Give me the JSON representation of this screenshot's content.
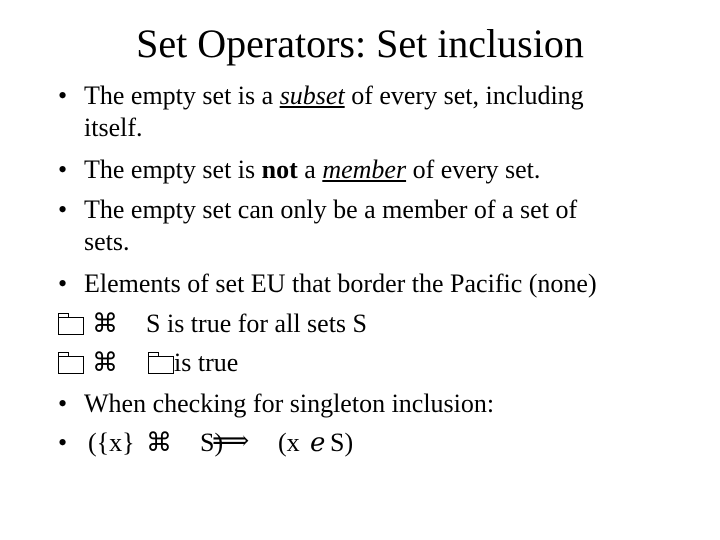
{
  "title": "Set Operators: Set inclusion",
  "bullet_char": "•",
  "items": [
    {
      "pre": "The empty set is a ",
      "em": "subset",
      "post": " of every set, including",
      "cont": "itself."
    },
    {
      "pre": "The empty set is ",
      "bold": "not",
      "mid": " a ",
      "em": "member",
      "post": " of every set."
    },
    {
      "text": "The empty set can only be a member of a set of",
      "cont": "sets."
    },
    {
      "text": "Elements of set EU that border the Pacific (none)"
    },
    {
      "symbol": "⌘",
      "s": "S",
      "rest": " is true for all sets S"
    },
    {
      "symbol": "⌘",
      "rest": " is true"
    },
    {
      "text": "When checking for singleton inclusion:"
    },
    {
      "left": "({x}",
      "symbol": "⌘",
      "s": "S)",
      "arrow": "⟹",
      "right_open": "(x",
      "member_symbol": "ℯ",
      "right_close": "S)"
    }
  ]
}
